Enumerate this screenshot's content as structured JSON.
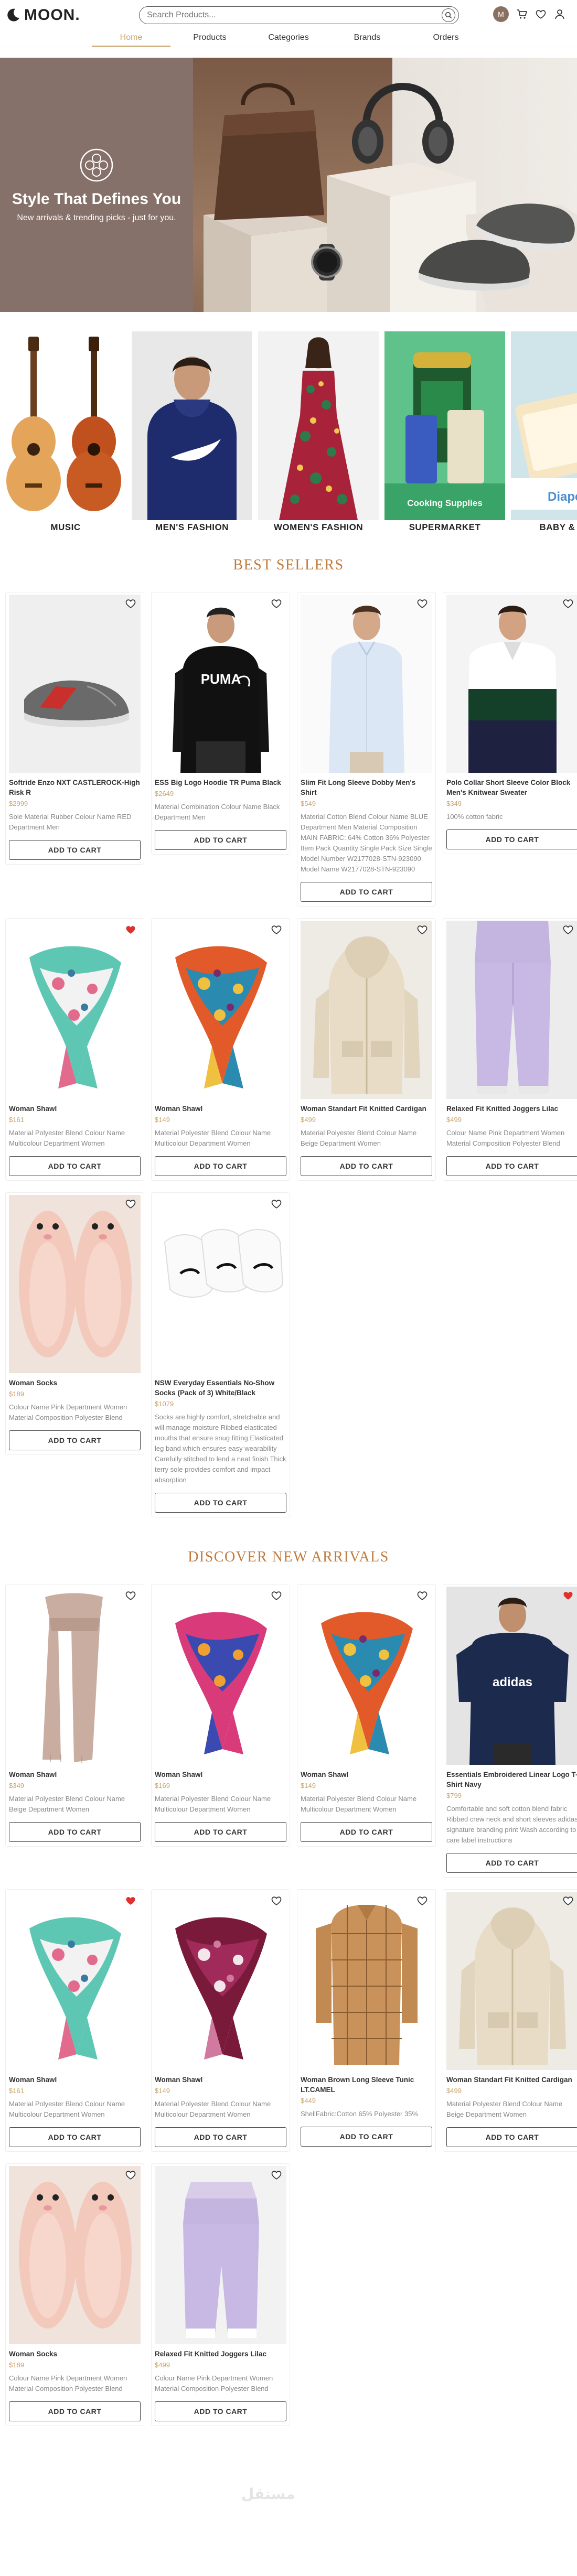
{
  "header": {
    "logo_text": "MOON.",
    "search_placeholder": "Search Products...",
    "avatar_initial": "M"
  },
  "nav": [
    {
      "label": "Home",
      "active": true
    },
    {
      "label": "Products"
    },
    {
      "label": "Categories"
    },
    {
      "label": "Brands"
    },
    {
      "label": "Orders"
    }
  ],
  "hero": {
    "title": "Style That Defines You",
    "subtitle": "New arrivals & trending picks - just for you."
  },
  "categories": [
    {
      "label": "MUSIC"
    },
    {
      "label": "MEN'S FASHION"
    },
    {
      "label": "WOMEN'S FASHION"
    },
    {
      "label": "SUPERMARKET",
      "overlay": "Cooking Supplies"
    },
    {
      "label": "BABY & TOYS",
      "overlay": "Diaper"
    }
  ],
  "best_sellers": {
    "title": "BEST SELLERS",
    "products": [
      {
        "name": "Softride Enzo NXT CASTLEROCK-High Risk R",
        "price": "$2999",
        "desc": "Sole Material Rubber Colour Name RED Department Men",
        "img": "shoe",
        "fav": false
      },
      {
        "name": "ESS Big Logo Hoodie TR Puma Black",
        "price": "$2649",
        "desc": "Material Combination Colour Name Black Department Men",
        "img": "hoodie-man",
        "fav": false
      },
      {
        "name": "Slim Fit Long Sleeve Dobby Men's Shirt",
        "price": "$549",
        "desc": "Material Cotton Blend Colour Name BLUE Department Men Material Composition MAIN FABRIC: 64% Cotton 36% Polyester Item Pack Quantity Single Pack Size Single Model Number W2177028-STN-923090 Model Name W2177028-STN-923090",
        "img": "shirt-man",
        "fav": false
      },
      {
        "name": "Polo Collar Short Sleeve Color Block Men's Knitwear Sweater",
        "price": "$349",
        "desc": "100% cotton fabric",
        "img": "polo-man",
        "fav": false
      },
      {
        "name": "Woman Shawl",
        "price": "$161",
        "desc": "Material Polyester Blend Colour Name Multicolour Department Women",
        "img": "scarf-mint",
        "fav": true
      },
      {
        "name": "Woman Shawl",
        "price": "$149",
        "desc": "Material Polyester Blend Colour Name Multicolour Department Women",
        "img": "scarf-orange",
        "fav": false
      },
      {
        "name": "Woman Standart Fit Knitted Cardigan",
        "price": "$499",
        "desc": "Material Polyester Blend Colour Name Beige Department Women",
        "img": "cardigan",
        "fav": false
      },
      {
        "name": "Relaxed Fit Knitted Joggers Lilac",
        "price": "$499",
        "desc": "Colour Name Pink Department Women Material Composition Polyester Blend",
        "img": "joggers",
        "fav": false
      },
      {
        "name": "Woman Socks",
        "price": "$189",
        "desc": "Colour Name Pink Department Women Material Composition Polyester Blend",
        "img": "slippers",
        "fav": false
      },
      {
        "name": "NSW Everyday Essentials No-Show Socks (Pack of 3) White/Black",
        "price": "$1079",
        "desc": "Socks are highly comfort, stretchable and will manage moisture Ribbed elasticated mouths that ensure snug fitting Elasticated leg band which ensures easy wearability Carefully stitched to lend a neat finish Thick terry sole provides comfort and impact absorption",
        "img": "socks",
        "fav": false
      }
    ]
  },
  "new_arrivals": {
    "title": "DISCOVER NEW ARRIVALS",
    "products": [
      {
        "name": "Woman Shawl",
        "price": "$349",
        "desc": "Material Polyester Blend Colour Name Beige Department Women",
        "img": "scarf-beige",
        "fav": false
      },
      {
        "name": "Woman Shawl",
        "price": "$169",
        "desc": "Material Polyester Blend Colour Name Multicolour Department Women",
        "img": "scarf-pinkblue",
        "fav": false
      },
      {
        "name": "Woman Shawl",
        "price": "$149",
        "desc": "Material Polyester Blend Colour Name Multicolour Department Women",
        "img": "scarf-orange",
        "fav": false
      },
      {
        "name": "Essentials Embroidered Linear Logo T-Shirt Navy",
        "price": "$799",
        "desc": "Comfortable and soft cotton blend fabric Ribbed crew neck and short sleeves adidas signature branding print Wash according to care label instructions",
        "img": "tshirt",
        "fav": true
      },
      {
        "name": "Woman Shawl",
        "price": "$161",
        "desc": "Material Polyester Blend Colour Name Multicolour Department Women",
        "img": "scarf-mint",
        "fav": true
      },
      {
        "name": "Woman Shawl",
        "price": "$149",
        "desc": "Material Polyester Blend Colour Name Multicolour Department Women",
        "img": "scarf-burgundy",
        "fav": false
      },
      {
        "name": "Woman Brown Long Sleeve Tunic LT.CAMEL",
        "price": "$449",
        "desc": "ShellFabric:Cotton 65% Polyester 35%",
        "img": "tunic",
        "fav": false
      },
      {
        "name": "Woman Standart Fit Knitted Cardigan",
        "price": "$499",
        "desc": "Material Polyester Blend Colour Name Beige Department Women",
        "img": "cardigan",
        "fav": false
      },
      {
        "name": "Woman Socks",
        "price": "$189",
        "desc": "Colour Name Pink Department Women Material Composition Polyester Blend",
        "img": "slippers",
        "fav": false
      },
      {
        "name": "Relaxed Fit Knitted Joggers Lilac",
        "price": "$499",
        "desc": "Colour Name Pink Department Women Material Composition Polyester Blend",
        "img": "joggers2",
        "fav": false
      }
    ]
  },
  "add_to_cart_label": "ADD TO CART",
  "watermark": "مستقل",
  "colors": {
    "accent": "#c9a36a",
    "section_title": "#c07a3c",
    "favorite": "#e03030"
  }
}
